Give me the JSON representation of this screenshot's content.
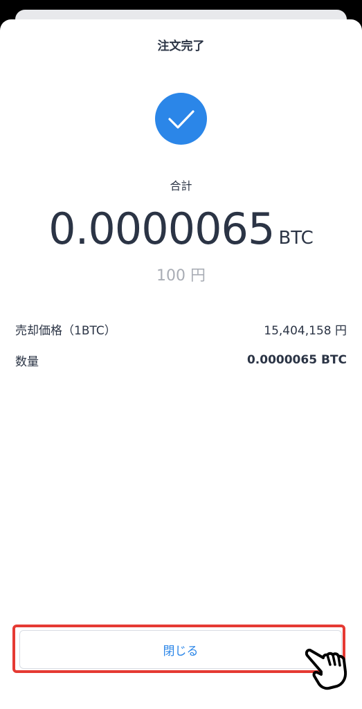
{
  "header": {
    "title": "注文完了"
  },
  "status": {
    "icon": "check-circle-icon",
    "accent_color": "#2b86e8"
  },
  "summary": {
    "total_label": "合計",
    "amount": "0.0000065",
    "unit": "BTC",
    "fiat_value": "100 円"
  },
  "details": {
    "price_label": "売却価格（1BTC）",
    "price_value": "15,404,158 円",
    "quantity_label": "数量",
    "quantity_value": "0.0000065 BTC"
  },
  "footer": {
    "close_label": "閉じる",
    "highlight_color": "#e53a33",
    "pointer_icon": "pointing-hand-icon"
  }
}
